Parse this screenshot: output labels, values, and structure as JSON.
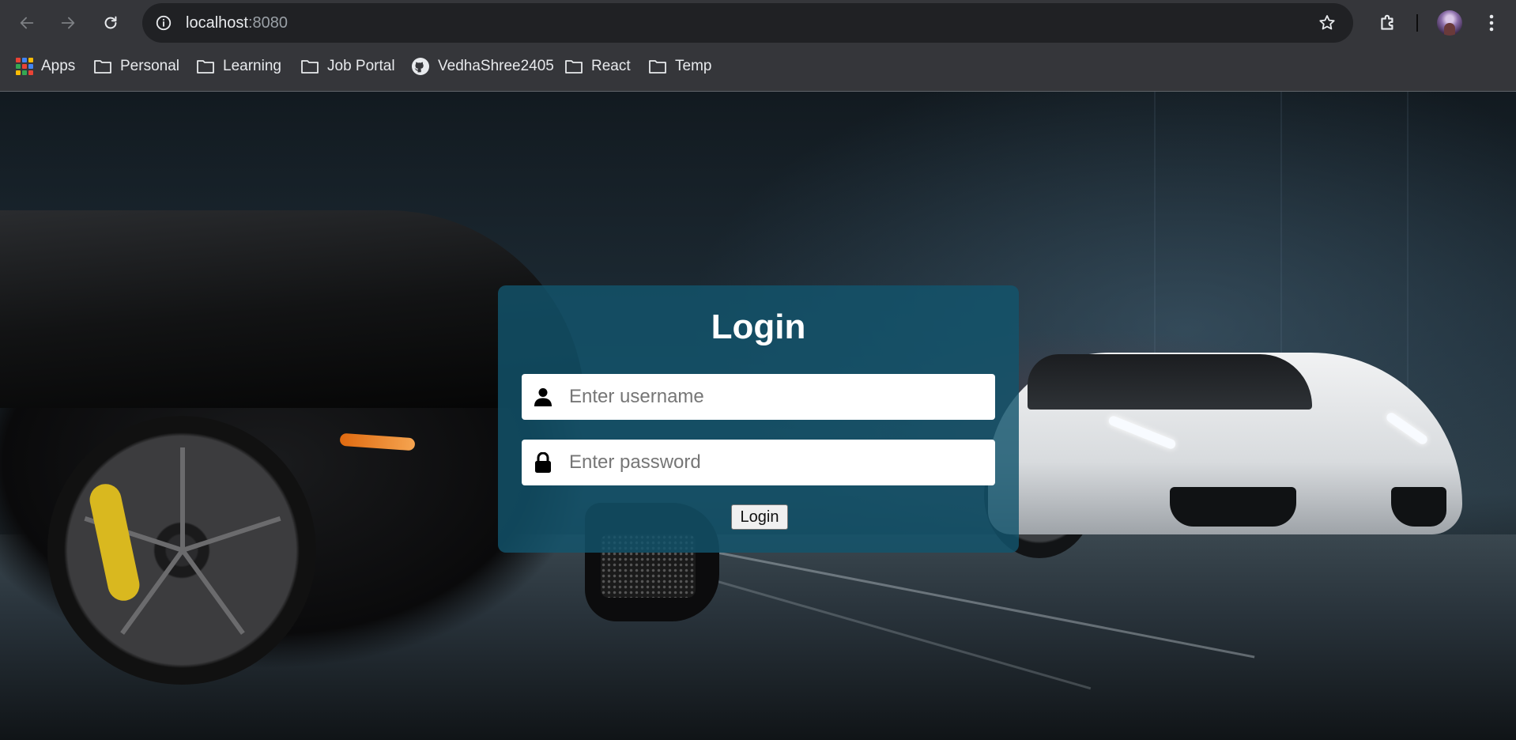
{
  "browser": {
    "url_host": "localhost",
    "url_port": ":8080",
    "bookmarks": [
      {
        "label": "Apps",
        "icon": "apps-grid-icon"
      },
      {
        "label": "Personal",
        "icon": "folder-icon"
      },
      {
        "label": "Learning",
        "icon": "folder-icon"
      },
      {
        "label": "Job Portal",
        "icon": "folder-icon"
      },
      {
        "label": "VedhaShree2405",
        "icon": "github-icon"
      },
      {
        "label": "React",
        "icon": "folder-icon"
      },
      {
        "label": "Temp",
        "icon": "folder-icon"
      }
    ]
  },
  "login": {
    "title": "Login",
    "username_placeholder": "Enter username",
    "password_placeholder": "Enter password",
    "button_label": "Login"
  },
  "colors": {
    "card_background": "#12546c",
    "chrome_background": "#35363a",
    "omnibox_background": "#202124"
  }
}
